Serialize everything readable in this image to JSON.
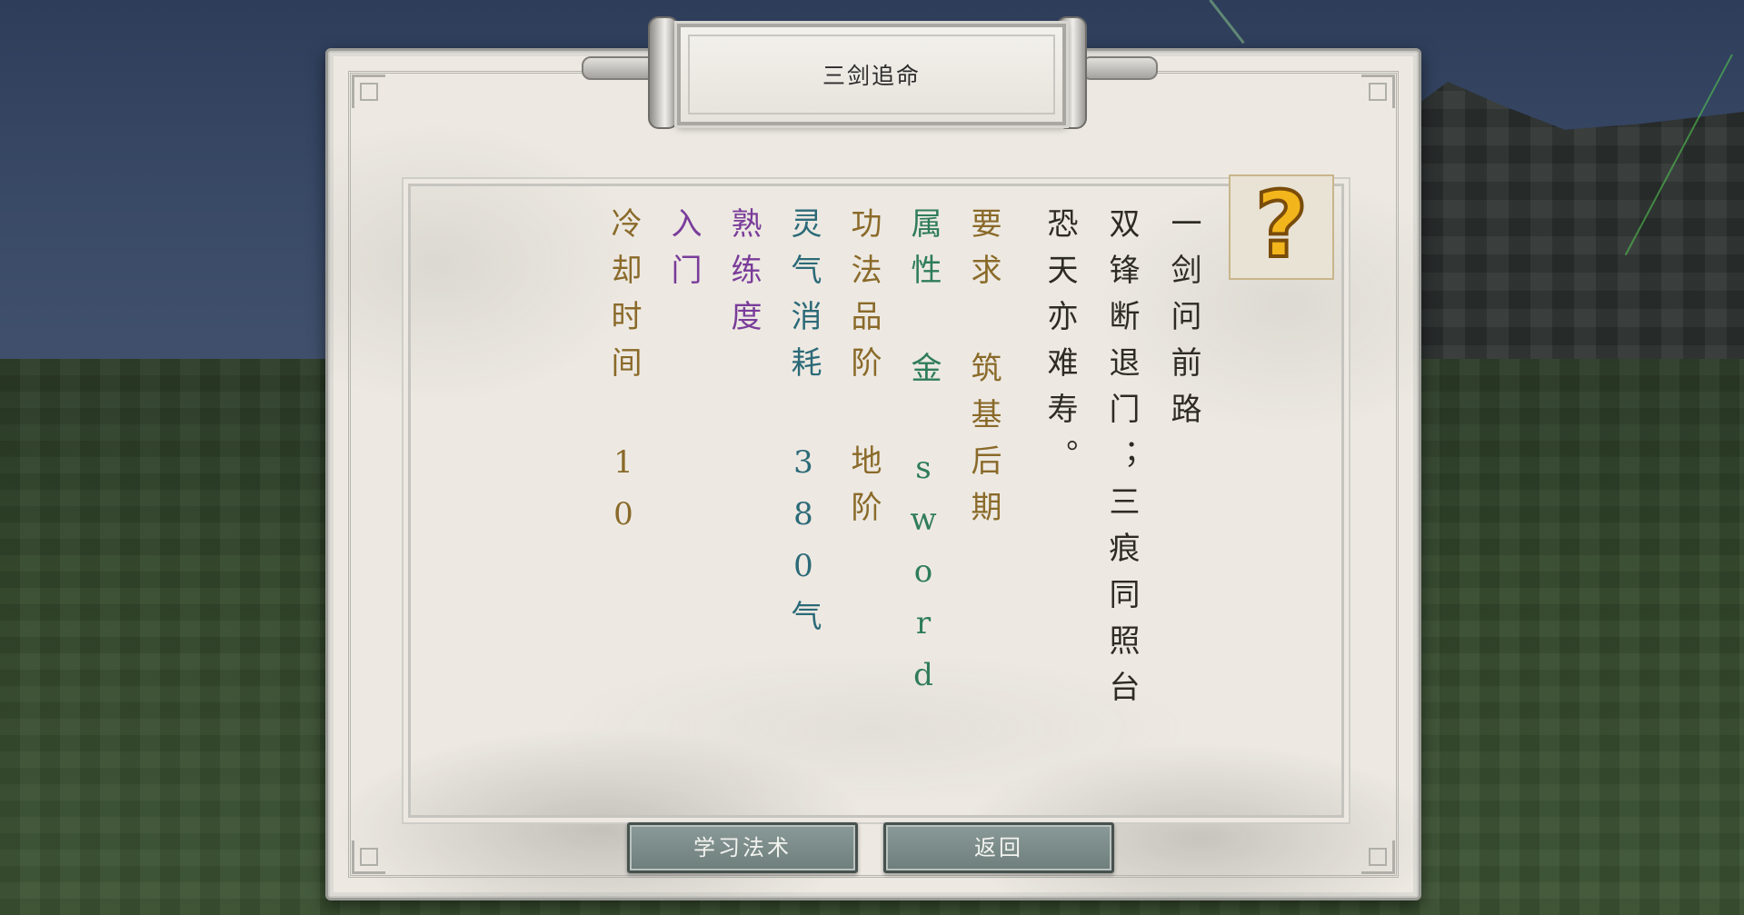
{
  "panel": {
    "title": "三剑追命"
  },
  "verse": {
    "line1": "一剑问前路",
    "line2": "双锋断退门；三痕同照台",
    "line3": "恐天亦难寿。"
  },
  "attributes": {
    "requirement": "要求 筑基后期",
    "element": "属性 金 sword",
    "grade": "功法品阶 地阶",
    "cost": "灵气消耗 380气",
    "proficiency_label": "熟练度",
    "proficiency_value": "入门",
    "cooldown": "冷却时间 10"
  },
  "help": {
    "icon": "question-mark-icon",
    "glyph": "?"
  },
  "buttons": {
    "learn": "学习法术",
    "back": "返回"
  },
  "colors": {
    "gold": "#8a6a2a",
    "green": "#2f7c5a",
    "teal": "#2c6a78",
    "purple": "#7a3c9a",
    "verse": "#2e2a24"
  }
}
